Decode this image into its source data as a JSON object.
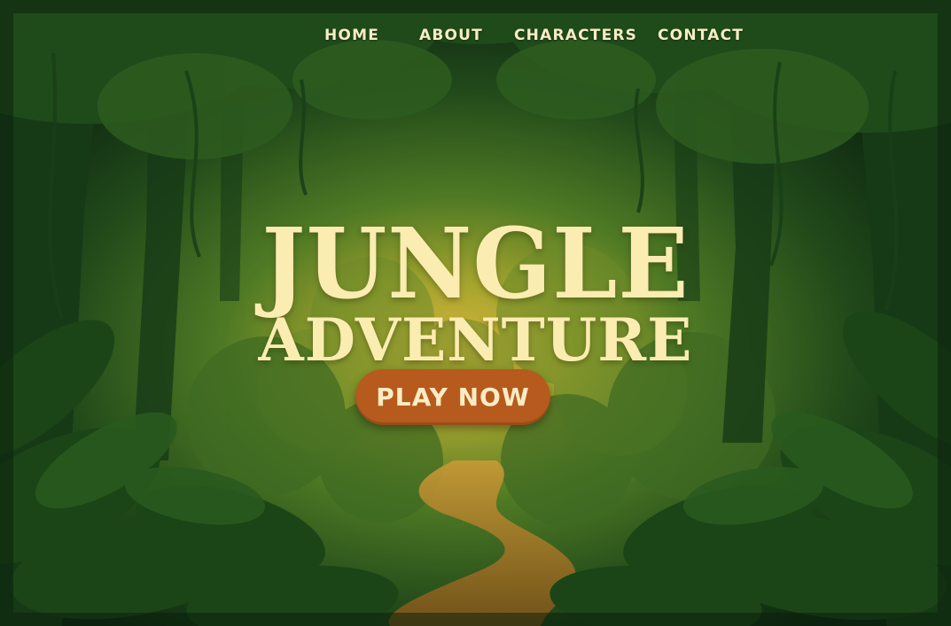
{
  "nav": {
    "items": [
      {
        "label": "HOME"
      },
      {
        "label": "ABOUT"
      },
      {
        "label": "CHARACTERS"
      },
      {
        "label": "CONTACT"
      }
    ]
  },
  "hero": {
    "title_line1": "JUNGLE",
    "title_line2": "ADVENTURE",
    "cta_label": "PLAY NOW"
  },
  "colors": {
    "title_text": "#fbecb2",
    "nav_text": "#f6ecc4",
    "cta_background": "#b65a1d",
    "jungle_dark": "#0f2a12",
    "jungle_glow": "#d8b23a",
    "path": "#b8842a"
  }
}
